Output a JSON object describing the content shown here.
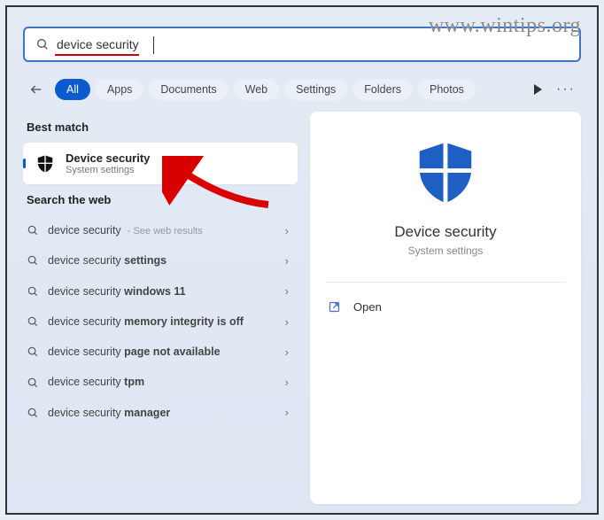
{
  "watermark": "www.wintips.org",
  "search": {
    "value": "device security"
  },
  "filters": {
    "items": [
      {
        "label": "All",
        "active": true
      },
      {
        "label": "Apps"
      },
      {
        "label": "Documents"
      },
      {
        "label": "Web"
      },
      {
        "label": "Settings"
      },
      {
        "label": "Folders"
      },
      {
        "label": "Photos"
      }
    ]
  },
  "sections": {
    "best_match": "Best match",
    "search_web": "Search the web"
  },
  "best": {
    "title": "Device security",
    "subtitle": "System settings"
  },
  "web_results": [
    {
      "prefix": "device security",
      "bold": "",
      "hint": " - See web results"
    },
    {
      "prefix": "device security ",
      "bold": "settings",
      "hint": ""
    },
    {
      "prefix": "device security ",
      "bold": "windows 11",
      "hint": ""
    },
    {
      "prefix": "device security ",
      "bold": "memory integrity is off",
      "hint": ""
    },
    {
      "prefix": "device security ",
      "bold": "page not available",
      "hint": ""
    },
    {
      "prefix": "device security ",
      "bold": "tpm",
      "hint": ""
    },
    {
      "prefix": "device security ",
      "bold": "manager",
      "hint": ""
    }
  ],
  "detail": {
    "title": "Device security",
    "subtitle": "System settings",
    "open": "Open"
  }
}
